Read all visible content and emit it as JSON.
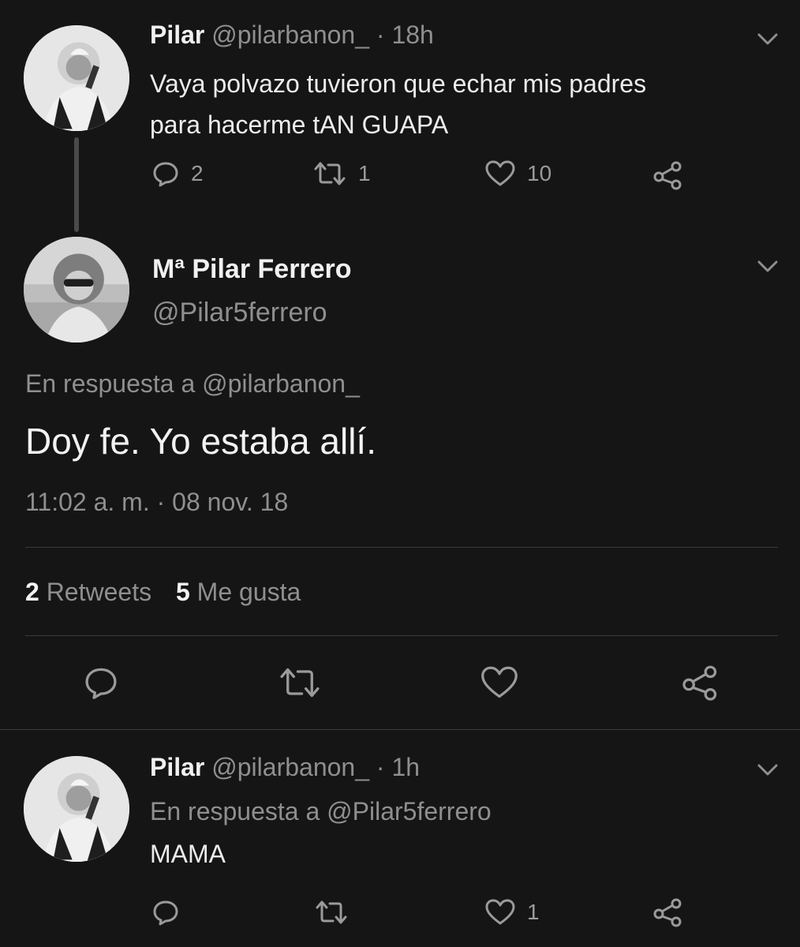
{
  "tweet1": {
    "name": "Pilar",
    "handle": "@pilarbanon_",
    "time": "· 18h",
    "text_line1": "Vaya polvazo tuvieron que echar mis padres",
    "text_line2": "para hacerme tAN GUAPA",
    "replies": "2",
    "retweets": "1",
    "likes": "10"
  },
  "main_tweet": {
    "name": "Mª Pilar Ferrero",
    "handle": "@Pilar5ferrero",
    "reply_to": "En respuesta a @pilarbanon_",
    "text": "Doy fe. Yo estaba allí.",
    "timestamp": "11:02 a. m. · 08 nov. 18",
    "retweet_count": "2",
    "retweet_label": "Retweets",
    "like_count": "5",
    "like_label": "Me gusta"
  },
  "tweet3": {
    "name": "Pilar",
    "handle": "@pilarbanon_",
    "time": "· 1h",
    "reply_to": "En respuesta a @Pilar5ferrero",
    "text": "MAMA",
    "likes": "1"
  },
  "icons": {
    "reply": "reply-icon",
    "retweet": "retweet-icon",
    "like": "heart-icon",
    "share": "share-icon",
    "menu": "chevron-down-icon"
  },
  "colors": {
    "background": "#151515",
    "text": "#e9e9e9",
    "muted": "#8f8f8f"
  }
}
